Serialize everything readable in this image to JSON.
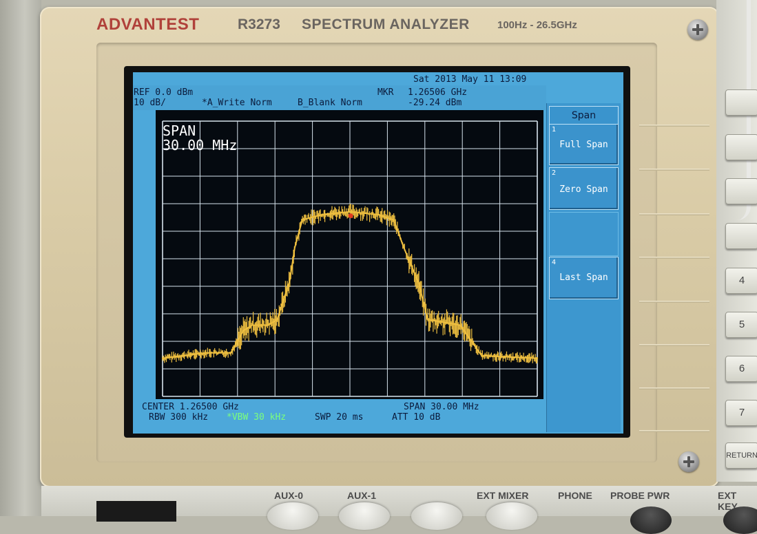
{
  "instrument": {
    "brand": "ADVANTEST",
    "model": "R3273",
    "title": "SPECTRUM ANALYZER",
    "range": "100Hz - 26.5GHz"
  },
  "status": {
    "datetime": "Sat 2013 May 11 13:09",
    "ref_level": "REF 0.0 dBm",
    "scale": "10 dB/",
    "trace_a": "*A_Write Norm",
    "trace_b": "B_Blank Norm",
    "marker_label": "MKR",
    "marker_freq": "1.26506 GHz",
    "marker_level": "-29.24 dBm"
  },
  "overlay": {
    "line1": "SPAN",
    "line2": "30.00 MHz"
  },
  "bottom": {
    "center": "CENTER 1.26500 GHz",
    "span": "SPAN 30.00 MHz",
    "rbw": "RBW 300 kHz",
    "vbw": "*VBW 30 kHz",
    "sweep": "SWP 20 ms",
    "att": "ATT 10 dB"
  },
  "softkeys": {
    "menu_title": "Span",
    "items": [
      {
        "num": "1",
        "label": "Full Span"
      },
      {
        "num": "2",
        "label": "Zero Span"
      },
      {
        "num": "4",
        "label": "Last Span"
      }
    ]
  },
  "keypad": {
    "keys": [
      "4",
      "5",
      "6",
      "7",
      "RETURN"
    ]
  },
  "front_panel": {
    "labels": [
      "AUX-0",
      "AUX-1",
      "EXT MIXER",
      "PHONE",
      "PROBE PWR",
      "EXT KEY"
    ]
  },
  "colors": {
    "screen": "#4da8da",
    "trace": "#f0c040",
    "marker": "#e03a1e",
    "vbw_text": "#7cff7c",
    "brand": "#b0413a"
  },
  "chart_data": {
    "type": "line",
    "x_unit": "GHz",
    "y_unit": "dBm",
    "xlim": [
      1.25,
      1.28
    ],
    "ylim": [
      -100,
      0
    ],
    "grid": true,
    "x": [
      1.25,
      1.2535,
      1.2555,
      1.2565,
      1.2572,
      1.2585,
      1.2592,
      1.2602,
      1.2606,
      1.2612,
      1.2628,
      1.265,
      1.2672,
      1.2685,
      1.2693,
      1.2705,
      1.2712,
      1.2725,
      1.2738,
      1.2755,
      1.28
    ],
    "y": [
      -86,
      -84,
      -84,
      -76,
      -74,
      -74,
      -72,
      -58,
      -46,
      -36,
      -34,
      -33,
      -34,
      -36,
      -46,
      -59,
      -72,
      -73,
      -74,
      -85,
      -86
    ],
    "marker": {
      "x": 1.26506,
      "y": -29.24
    }
  }
}
